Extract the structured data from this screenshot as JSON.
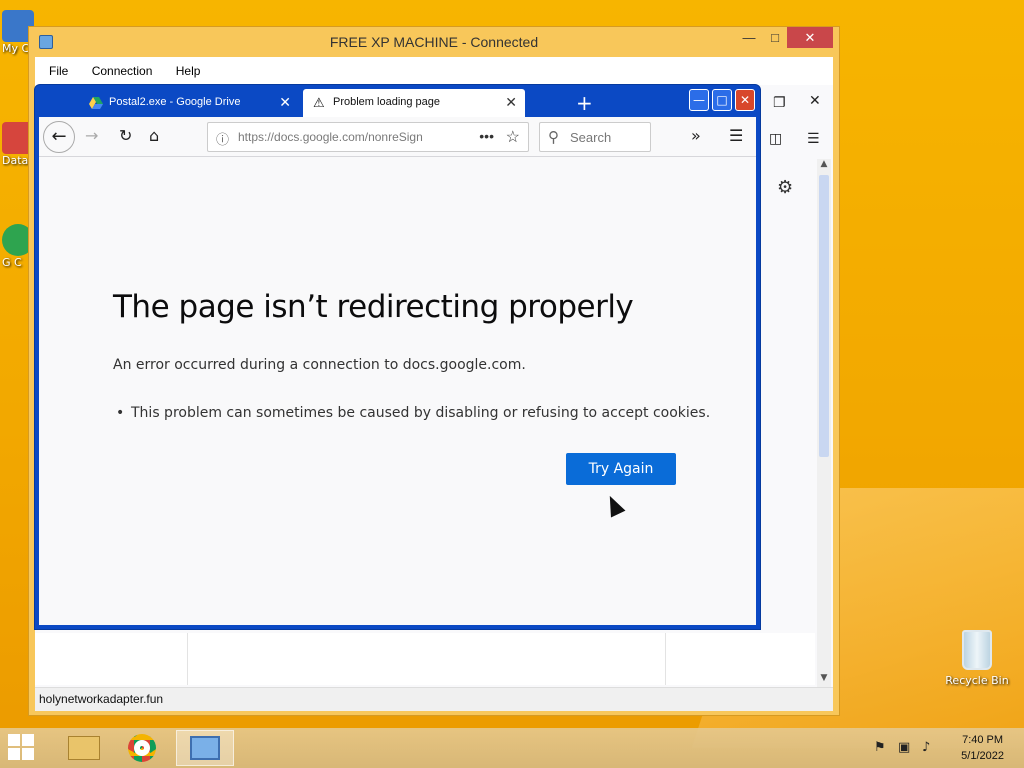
{
  "desktop": {
    "icons": [
      {
        "label": "My C"
      },
      {
        "label": "Data"
      },
      {
        "label": "G C"
      }
    ],
    "recycle_bin_label": "Recycle Bin"
  },
  "rdp_window": {
    "title": "FREE XP MACHINE - Connected",
    "menu": [
      "File",
      "Connection",
      "Help"
    ],
    "status_text": "holynetworkadapter.fun"
  },
  "browser": {
    "tabs": [
      {
        "label": "Postal2.exe - Google Drive",
        "active": false
      },
      {
        "label": "Problem loading page",
        "active": true
      }
    ],
    "new_tab_label": "+",
    "url": "https://docs.google.com/nonreSign",
    "search_placeholder": "Search"
  },
  "error_page": {
    "title": "The page isn’t redirecting properly",
    "description": "An error occurred during a connection to docs.google.com.",
    "bullet": "This problem can sometimes be caused by disabling or refusing to accept cookies.",
    "button_label": "Try Again"
  },
  "taskbar": {
    "time": "7:40 PM",
    "date": "5/1/2022"
  },
  "colors": {
    "desktop": "#f2a800",
    "xp_frame": "#0b49c4",
    "primary_button": "#0a6cd8"
  }
}
